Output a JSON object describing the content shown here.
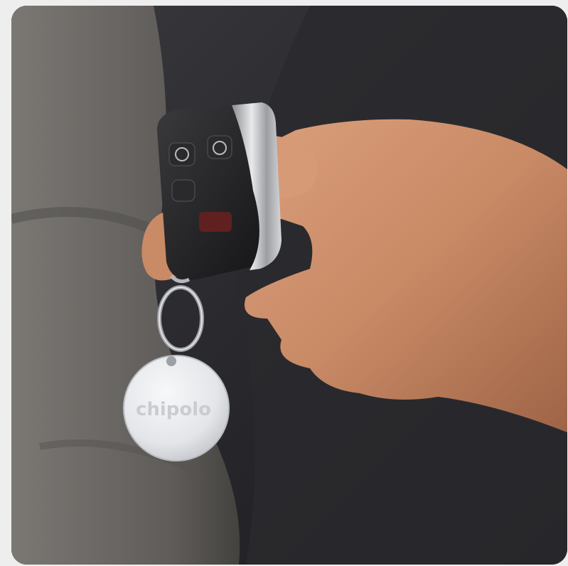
{
  "photo": {
    "subject": "hand-holding-car-key-fob-with-tracker",
    "tracker_brand": "chipolo",
    "colors": {
      "page_background": "#eeeeee",
      "sofa_dark": "#2b2b2f",
      "cushion_grey": "#6f6d6a",
      "key_fob_black": "#1d1d1f",
      "tracker_white": "#e9eaec",
      "skin": "#c98a66"
    }
  }
}
